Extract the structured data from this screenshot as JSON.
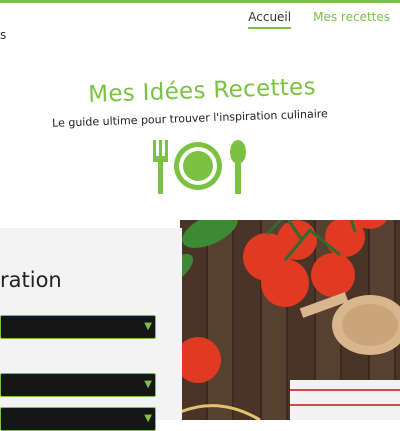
{
  "header": {
    "logo_fragment": "s"
  },
  "nav": {
    "items": [
      {
        "label": "Accueil",
        "active": true
      },
      {
        "label": "Mes recettes",
        "active": false
      }
    ]
  },
  "hero": {
    "title": "Mes Idées Recettes",
    "subtitle": "Le guide ultime pour trouver l'inspiration culinaire",
    "icon": "fork-plate-spoon-icon"
  },
  "form": {
    "heading_fragment": "ration",
    "selects": [
      {
        "value": ""
      },
      {
        "value": ""
      },
      {
        "value": ""
      }
    ]
  },
  "colors": {
    "accent": "#7cc242",
    "dark": "#161616"
  }
}
